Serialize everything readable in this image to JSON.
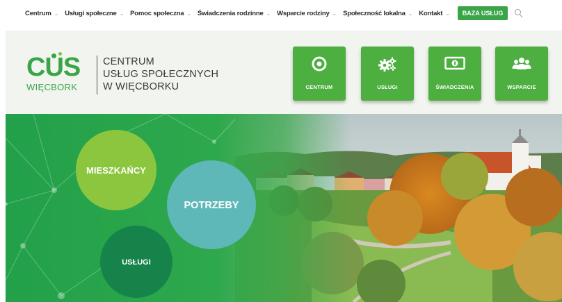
{
  "nav": {
    "items": [
      {
        "label": "Centrum"
      },
      {
        "label": "Usługi społeczne"
      },
      {
        "label": "Pomoc społeczna"
      },
      {
        "label": "Świadczenia rodzinne"
      },
      {
        "label": "Wsparcie rodziny"
      },
      {
        "label": "Społeczność lokalna"
      },
      {
        "label": "Kontakt"
      }
    ],
    "cta": "BAZA USŁUG",
    "search_icon": "search-icon"
  },
  "header": {
    "logo_main": "CUS",
    "logo_sub": "WIĘCBORK",
    "title_lines": [
      "CENTRUM",
      "USŁUG SPOŁECZNYCH",
      "W WIĘCBORKU"
    ],
    "tiles": [
      {
        "label": "CENTRUM",
        "icon": "target-icon"
      },
      {
        "label": "USŁUGI",
        "icon": "gears-icon"
      },
      {
        "label": "ŚWIADCZENIA",
        "icon": "banknote-icon"
      },
      {
        "label": "WSPARCIE",
        "icon": "people-icon"
      }
    ]
  },
  "hero": {
    "circles": [
      {
        "label": "MIESZKAŃCY"
      },
      {
        "label": "POTRZEBY"
      },
      {
        "label": "USŁUGI"
      }
    ]
  },
  "colors": {
    "brand_green": "#3aa548",
    "tile_green": "#4caf3f",
    "circle_lime": "#8cc63f",
    "circle_teal": "#5fb8b8",
    "circle_dark": "#16844a"
  }
}
